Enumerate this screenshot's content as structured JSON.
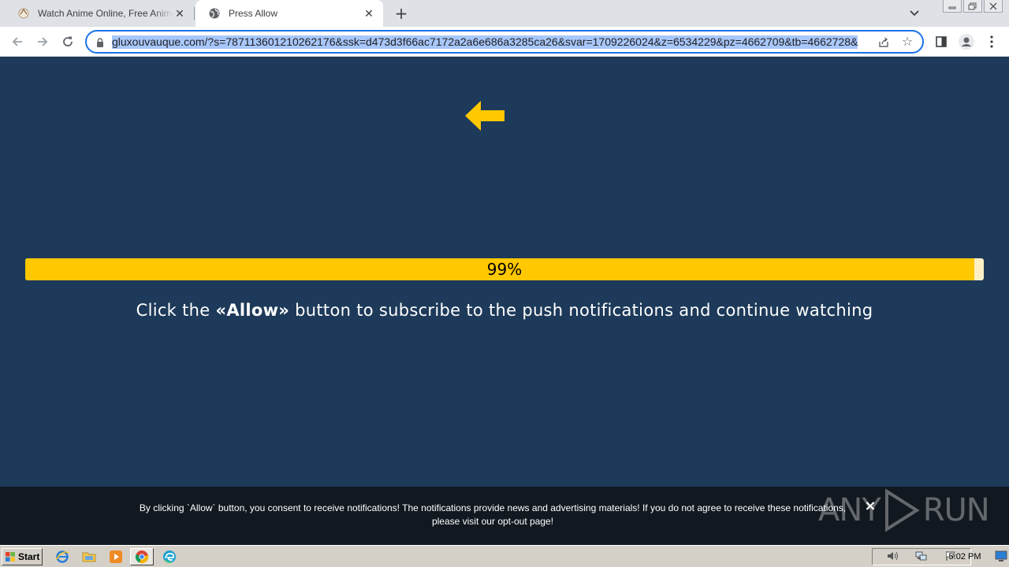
{
  "browser": {
    "tabs": [
      {
        "title": "Watch Anime Online, Free Anime Streaming",
        "favicon": "anime-site-icon",
        "active": false
      },
      {
        "title": "Press Allow",
        "favicon": "globe-icon",
        "active": true
      }
    ],
    "new_tab_label": "+",
    "url": "gluxouvauque.com/?s=787113601210262176&ssk=d473d3f66ac7172a2a6e686a3285ca26&svar=1709226024&z=6534229&pz=4662709&tb=4662728&",
    "accent_color": "#1a73e8",
    "url_highlight_color": "#a8c7fa"
  },
  "page": {
    "background_color": "#1e3a5a",
    "arrow_color": "#ffc800",
    "progress": {
      "percent": 99,
      "label": "99%",
      "fill_color": "#ffc800"
    },
    "cta": {
      "before": "Click the ",
      "emphasis": "«Allow»",
      "after": " button to subscribe to the push notifications and continue watching"
    }
  },
  "consent": {
    "line1": "By clicking `Allow` button, you consent to receive notifications! The notifications provide news and advertising materials! If you do not agree to receive these notifications,",
    "line2_prefix": "please visit our ",
    "link": "opt-out page",
    "line2_suffix": "!",
    "close_label": "×"
  },
  "watermark": {
    "left": "ANY",
    "right": "RUN"
  },
  "taskbar": {
    "start_label": "Start",
    "pinned": [
      "ie-icon",
      "folder-icon",
      "media-player-icon",
      "chrome-icon",
      "edge-icon"
    ],
    "tray": [
      "speaker-icon",
      "network-icon",
      "action-center-flag-icon"
    ],
    "clock": "5:02 PM"
  }
}
